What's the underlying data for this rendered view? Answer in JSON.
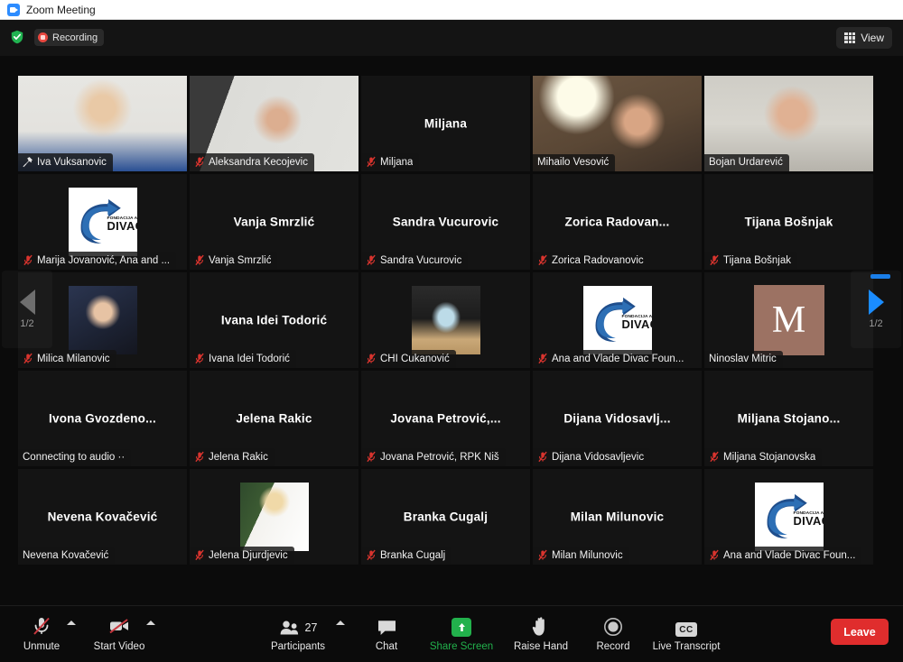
{
  "window": {
    "title": "Zoom Meeting",
    "app_icon": "zoom-video-icon"
  },
  "topbar": {
    "shield_icon": "encryption-shield-icon",
    "recording_label": "Recording",
    "recording_icon": "record-stop-icon",
    "view_label": "View",
    "view_icon": "grid-view-icon"
  },
  "pagination": {
    "prev_label": "1/2",
    "next_label": "1/2",
    "prev_icon": "chevron-left-icon",
    "next_icon": "chevron-right-icon"
  },
  "gallery": {
    "tiles": [
      {
        "display_name": "Iva Vuksanovic",
        "nameplate": "Iva Vuksanovic",
        "muted": false,
        "pinned": true,
        "active_speaker": true,
        "content": "video",
        "video": "woman-blonde-blue-top"
      },
      {
        "display_name": "Aleksandra Kecojevic",
        "nameplate": "Aleksandra Kecojevic",
        "muted": true,
        "pinned": false,
        "active_speaker": false,
        "content": "video",
        "video": "woman-glasses-office"
      },
      {
        "display_name": "Miljana",
        "nameplate": "Miljana",
        "muted": true,
        "pinned": false,
        "active_speaker": false,
        "content": "name"
      },
      {
        "display_name": "",
        "nameplate": "Mihailo Vesović",
        "muted": false,
        "pinned": false,
        "active_speaker": false,
        "content": "video",
        "video": "man-glasses-lamp"
      },
      {
        "display_name": "",
        "nameplate": "Bojan Urdarević",
        "muted": false,
        "pinned": false,
        "active_speaker": false,
        "content": "video",
        "video": "man-light-shirt"
      },
      {
        "display_name": "",
        "nameplate": "Marija Jovanović, Ana and ...",
        "muted": true,
        "pinned": false,
        "active_speaker": false,
        "content": "avatar-divac"
      },
      {
        "display_name": "Vanja Smrzlić",
        "nameplate": "Vanja Smrzlić",
        "muted": true,
        "pinned": false,
        "active_speaker": false,
        "content": "name"
      },
      {
        "display_name": "Sandra Vucurovic",
        "nameplate": "Sandra Vucurovic",
        "muted": true,
        "pinned": false,
        "active_speaker": false,
        "content": "name"
      },
      {
        "display_name": "Zorica  Radovan...",
        "nameplate": "Zorica Radovanovic",
        "muted": true,
        "pinned": false,
        "active_speaker": false,
        "content": "name"
      },
      {
        "display_name": "Tijana Bošnjak",
        "nameplate": "Tijana Bošnjak",
        "muted": true,
        "pinned": false,
        "active_speaker": false,
        "content": "name"
      },
      {
        "display_name": "",
        "nameplate": "Milica Milanovic",
        "muted": true,
        "pinned": false,
        "active_speaker": false,
        "content": "avatar-photo",
        "avatar": "woman-portrait-dark"
      },
      {
        "display_name": "Ivana Idei Todorić",
        "nameplate": "Ivana Idei Todorić",
        "muted": true,
        "pinned": false,
        "active_speaker": false,
        "content": "name"
      },
      {
        "display_name": "",
        "nameplate": "CHI Čukanović",
        "muted": true,
        "pinned": false,
        "active_speaker": false,
        "content": "avatar-photo",
        "avatar": "plaque-award-photo"
      },
      {
        "display_name": "",
        "nameplate": "Ana and Vlade Divac Foun...",
        "muted": true,
        "pinned": false,
        "active_speaker": false,
        "content": "avatar-divac"
      },
      {
        "display_name": "",
        "nameplate": "Ninoslav Mitric",
        "muted": false,
        "pinned": false,
        "active_speaker": false,
        "content": "avatar-letter",
        "letter": "M"
      },
      {
        "display_name": "Ivona  Gvozdeno...",
        "nameplate": "Connecting to audio ··",
        "muted": false,
        "pinned": false,
        "active_speaker": false,
        "content": "name"
      },
      {
        "display_name": "Jelena Rakic",
        "nameplate": "Jelena Rakic",
        "muted": true,
        "pinned": false,
        "active_speaker": false,
        "content": "name"
      },
      {
        "display_name": "Jovana  Petrović,...",
        "nameplate": "Jovana Petrović, RPK Niš",
        "muted": true,
        "pinned": false,
        "active_speaker": false,
        "content": "name"
      },
      {
        "display_name": "Dijana  Vidosavlj...",
        "nameplate": "Dijana Vidosavljevic",
        "muted": true,
        "pinned": false,
        "active_speaker": false,
        "content": "name"
      },
      {
        "display_name": "Miljana  Stojano...",
        "nameplate": "Miljana Stojanovska",
        "muted": true,
        "pinned": false,
        "active_speaker": false,
        "content": "name"
      },
      {
        "display_name": "Nevena Kovačević",
        "nameplate": "Nevena Kovačević",
        "muted": false,
        "pinned": false,
        "active_speaker": false,
        "content": "name"
      },
      {
        "display_name": "",
        "nameplate": "Jelena Djurdjevic",
        "muted": true,
        "pinned": false,
        "active_speaker": false,
        "content": "avatar-photo",
        "avatar": "woman-blonde-white-shirt"
      },
      {
        "display_name": "Branka Cugalj",
        "nameplate": "Branka Cugalj",
        "muted": true,
        "pinned": false,
        "active_speaker": false,
        "content": "name"
      },
      {
        "display_name": "Milan Milunovic",
        "nameplate": "Milan Milunovic",
        "muted": true,
        "pinned": false,
        "active_speaker": false,
        "content": "name"
      },
      {
        "display_name": "",
        "nameplate": "Ana and Vlade Divac Foun...",
        "muted": true,
        "pinned": false,
        "active_speaker": false,
        "content": "avatar-divac"
      }
    ]
  },
  "toolbar": {
    "unmute_label": "Unmute",
    "start_video_label": "Start Video",
    "participants_label": "Participants",
    "participants_count": "27",
    "chat_label": "Chat",
    "share_screen_label": "Share Screen",
    "raise_hand_label": "Raise Hand",
    "record_label": "Record",
    "live_transcript_label": "Live Transcript",
    "live_transcript_badge": "CC",
    "leave_label": "Leave"
  },
  "colors": {
    "accent_blue": "#1a8cff",
    "active_speaker": "#e5f03c",
    "leave_red": "#e02d2d",
    "share_green": "#22b14c",
    "recording_red": "#e8473f"
  },
  "logo": {
    "divac_top": "FONDACIJA ANA I VLADE",
    "divac_name": "DIVAC"
  }
}
